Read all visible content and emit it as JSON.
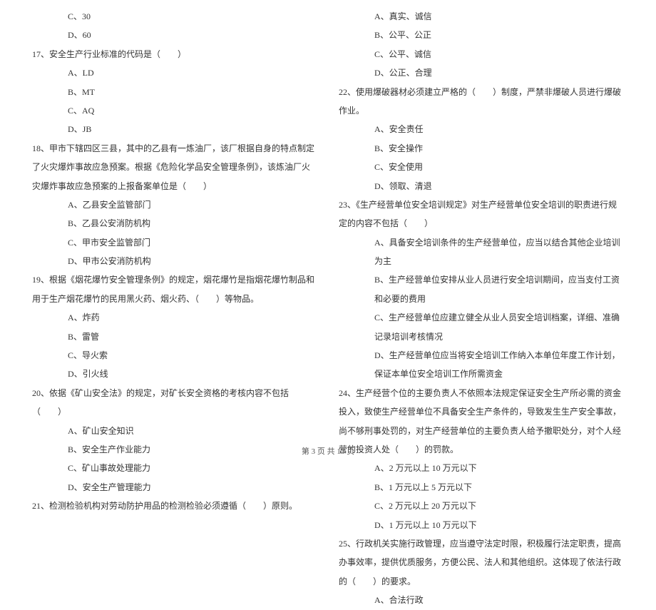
{
  "left": {
    "opt_c30": "C、30",
    "opt_d60": "D、60",
    "q17": "17、安全生产行业标准的代码是（　　）",
    "q17_a": "A、LD",
    "q17_b": "B、MT",
    "q17_c": "C、AQ",
    "q17_d": "D、JB",
    "q18": "18、甲市下辖四区三县，其中的乙县有一炼油厂，该厂根据自身的特点制定了火灾爆炸事故应急预案。根据《危险化学品安全管理条例》，该炼油厂火灾爆炸事故应急预案的上报备案单位是（　　）",
    "q18_a": "A、乙县安全监管部门",
    "q18_b": "B、乙县公安消防机构",
    "q18_c": "C、甲市安全监管部门",
    "q18_d": "D、甲市公安消防机构",
    "q19": "19、根据《烟花爆竹安全管理条例》的规定，烟花爆竹是指烟花爆竹制品和用于生产烟花爆竹的民用黑火药、烟火药、（　　）等物品。",
    "q19_a": "A、炸药",
    "q19_b": "B、雷管",
    "q19_c": "C、导火索",
    "q19_d": "D、引火线",
    "q20": "20、依据《矿山安全法》的规定，对矿长安全资格的考核内容不包括（　　）",
    "q20_a": "A、矿山安全知识",
    "q20_b": "B、安全生产作业能力",
    "q20_c": "C、矿山事故处理能力",
    "q20_d": "D、安全生产管理能力",
    "q21": "21、检测检验机构对劳动防护用品的检测检验必须遵循（　　）原则。"
  },
  "right": {
    "q21_a": "A、真实、诚信",
    "q21_b": "B、公平、公正",
    "q21_c": "C、公平、诚信",
    "q21_d": "D、公正、合理",
    "q22": "22、使用爆破器材必须建立严格的（　　）制度，严禁非爆破人员进行爆破作业。",
    "q22_a": "A、安全责任",
    "q22_b": "B、安全操作",
    "q22_c": "C、安全使用",
    "q22_d": "D、领取、清退",
    "q23": "23、《生产经营单位安全培训规定》对生产经营单位安全培训的职责进行规定的内容不包括（　　）",
    "q23_a": "A、具备安全培训条件的生产经营单位，应当以结合其他企业培训为主",
    "q23_b": "B、生产经营单位安排从业人员进行安全培训期间，应当支付工资和必要的费用",
    "q23_c": "C、生产经营单位应建立健全从业人员安全培训档案，详细、准确记录培训考核情况",
    "q23_d": "D、生产经营单位应当将安全培训工作纳入本单位年度工作计划，保证本单位安全培训工作所需资金",
    "q24": "24、生产经营个位的主要负责人不依照本法规定保证安全生产所必需的资金投入，致使生产经营单位不具备安全生产条件的，导致发生生产安全事故，尚不够刑事处罚的，对生产经营单位的主要负责人给予撤职处分，对个人经营的投资人处（　　）的罚款。",
    "q24_a": "A、2 万元以上 10 万元以下",
    "q24_b": "B、1 万元以上 5 万元以下",
    "q24_c": "C、2 万元以上 20 万元以下",
    "q24_d": "D、1 万元以上 10 万元以下",
    "q25": "25、行政机关实施行政管理，应当遵守法定时限，积极履行法定职责，提高办事效率，提供优质服务，方便公民、法人和其他组织。这体现了依法行政的（　　）的要求。",
    "q25_a": "A、合法行政"
  },
  "footer": "第 3 页 共 13 页"
}
